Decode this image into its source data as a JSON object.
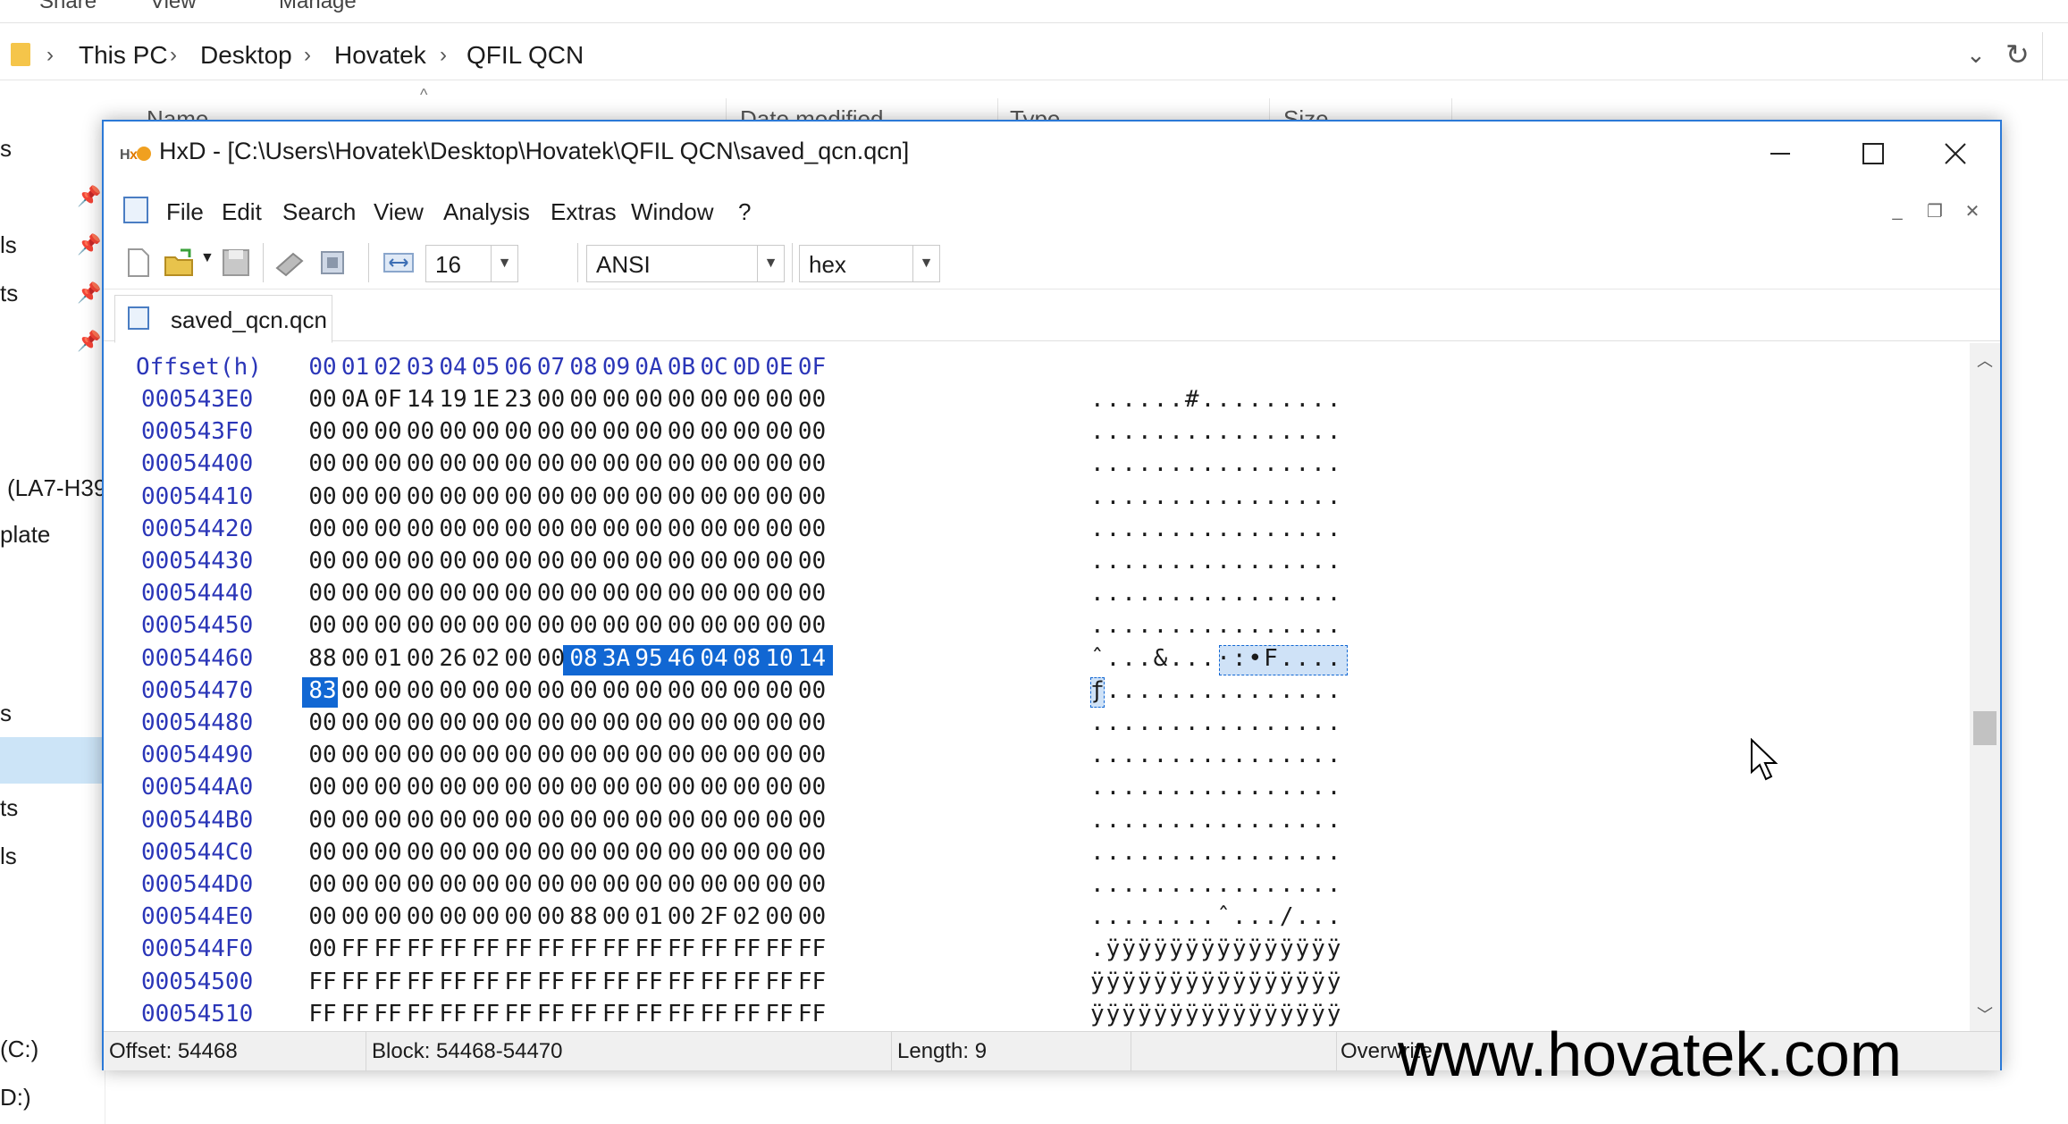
{
  "explorer": {
    "ribbon_tabs": [
      "Share",
      "View",
      "Manage"
    ],
    "breadcrumb": [
      "This PC",
      "Desktop",
      "Hovatek",
      "QFIL QCN"
    ],
    "columns": [
      "Name",
      "Date modified",
      "Type",
      "Size"
    ],
    "nav_items": [
      "s",
      "ls",
      "ts",
      "(LA7-H39",
      "plate",
      "s",
      "ts",
      "ls",
      "(C:)",
      "D:)"
    ]
  },
  "hxd": {
    "title": "HxD - [C:\\Users\\Hovatek\\Desktop\\Hovatek\\QFIL QCN\\saved_qcn.qcn]",
    "menu": [
      "File",
      "Edit",
      "Search",
      "View",
      "Analysis",
      "Extras",
      "Window",
      "?"
    ],
    "toolbar": {
      "bytes_per_row": "16",
      "charset": "ANSI",
      "offset_base": "hex"
    },
    "tab_label": "saved_qcn.qcn",
    "header": {
      "offset_label": "Offset(h)",
      "columns": [
        "00",
        "01",
        "02",
        "03",
        "04",
        "05",
        "06",
        "07",
        "08",
        "09",
        "0A",
        "0B",
        "0C",
        "0D",
        "0E",
        "0F"
      ]
    },
    "rows": [
      {
        "offset": "000543E0",
        "bytes": [
          "00",
          "0A",
          "0F",
          "14",
          "19",
          "1E",
          "23",
          "00",
          "00",
          "00",
          "00",
          "00",
          "00",
          "00",
          "00",
          "00"
        ],
        "ascii": "......#........."
      },
      {
        "offset": "000543F0",
        "bytes": [
          "00",
          "00",
          "00",
          "00",
          "00",
          "00",
          "00",
          "00",
          "00",
          "00",
          "00",
          "00",
          "00",
          "00",
          "00",
          "00"
        ],
        "ascii": "................"
      },
      {
        "offset": "00054400",
        "bytes": [
          "00",
          "00",
          "00",
          "00",
          "00",
          "00",
          "00",
          "00",
          "00",
          "00",
          "00",
          "00",
          "00",
          "00",
          "00",
          "00"
        ],
        "ascii": "................"
      },
      {
        "offset": "00054410",
        "bytes": [
          "00",
          "00",
          "00",
          "00",
          "00",
          "00",
          "00",
          "00",
          "00",
          "00",
          "00",
          "00",
          "00",
          "00",
          "00",
          "00"
        ],
        "ascii": "................"
      },
      {
        "offset": "00054420",
        "bytes": [
          "00",
          "00",
          "00",
          "00",
          "00",
          "00",
          "00",
          "00",
          "00",
          "00",
          "00",
          "00",
          "00",
          "00",
          "00",
          "00"
        ],
        "ascii": "................"
      },
      {
        "offset": "00054430",
        "bytes": [
          "00",
          "00",
          "00",
          "00",
          "00",
          "00",
          "00",
          "00",
          "00",
          "00",
          "00",
          "00",
          "00",
          "00",
          "00",
          "00"
        ],
        "ascii": "................"
      },
      {
        "offset": "00054440",
        "bytes": [
          "00",
          "00",
          "00",
          "00",
          "00",
          "00",
          "00",
          "00",
          "00",
          "00",
          "00",
          "00",
          "00",
          "00",
          "00",
          "00"
        ],
        "ascii": "................"
      },
      {
        "offset": "00054450",
        "bytes": [
          "00",
          "00",
          "00",
          "00",
          "00",
          "00",
          "00",
          "00",
          "00",
          "00",
          "00",
          "00",
          "00",
          "00",
          "00",
          "00"
        ],
        "ascii": "................"
      },
      {
        "offset": "00054460",
        "bytes": [
          "88",
          "00",
          "01",
          "00",
          "26",
          "02",
          "00",
          "00",
          "08",
          "3A",
          "95",
          "46",
          "04",
          "08",
          "10",
          "14"
        ],
        "ascii": "ˆ...&...·:•F...."
      },
      {
        "offset": "00054470",
        "bytes": [
          "83",
          "00",
          "00",
          "00",
          "00",
          "00",
          "00",
          "00",
          "00",
          "00",
          "00",
          "00",
          "00",
          "00",
          "00",
          "00"
        ],
        "ascii": "ƒ..............."
      },
      {
        "offset": "00054480",
        "bytes": [
          "00",
          "00",
          "00",
          "00",
          "00",
          "00",
          "00",
          "00",
          "00",
          "00",
          "00",
          "00",
          "00",
          "00",
          "00",
          "00"
        ],
        "ascii": "................"
      },
      {
        "offset": "00054490",
        "bytes": [
          "00",
          "00",
          "00",
          "00",
          "00",
          "00",
          "00",
          "00",
          "00",
          "00",
          "00",
          "00",
          "00",
          "00",
          "00",
          "00"
        ],
        "ascii": "................"
      },
      {
        "offset": "000544A0",
        "bytes": [
          "00",
          "00",
          "00",
          "00",
          "00",
          "00",
          "00",
          "00",
          "00",
          "00",
          "00",
          "00",
          "00",
          "00",
          "00",
          "00"
        ],
        "ascii": "................"
      },
      {
        "offset": "000544B0",
        "bytes": [
          "00",
          "00",
          "00",
          "00",
          "00",
          "00",
          "00",
          "00",
          "00",
          "00",
          "00",
          "00",
          "00",
          "00",
          "00",
          "00"
        ],
        "ascii": "................"
      },
      {
        "offset": "000544C0",
        "bytes": [
          "00",
          "00",
          "00",
          "00",
          "00",
          "00",
          "00",
          "00",
          "00",
          "00",
          "00",
          "00",
          "00",
          "00",
          "00",
          "00"
        ],
        "ascii": "................"
      },
      {
        "offset": "000544D0",
        "bytes": [
          "00",
          "00",
          "00",
          "00",
          "00",
          "00",
          "00",
          "00",
          "00",
          "00",
          "00",
          "00",
          "00",
          "00",
          "00",
          "00"
        ],
        "ascii": "................"
      },
      {
        "offset": "000544E0",
        "bytes": [
          "00",
          "00",
          "00",
          "00",
          "00",
          "00",
          "00",
          "00",
          "88",
          "00",
          "01",
          "00",
          "2F",
          "02",
          "00",
          "00"
        ],
        "ascii": "........ˆ.../..."
      },
      {
        "offset": "000544F0",
        "bytes": [
          "00",
          "FF",
          "FF",
          "FF",
          "FF",
          "FF",
          "FF",
          "FF",
          "FF",
          "FF",
          "FF",
          "FF",
          "FF",
          "FF",
          "FF",
          "FF"
        ],
        "ascii": ".ÿÿÿÿÿÿÿÿÿÿÿÿÿÿÿ"
      },
      {
        "offset": "00054500",
        "bytes": [
          "FF",
          "FF",
          "FF",
          "FF",
          "FF",
          "FF",
          "FF",
          "FF",
          "FF",
          "FF",
          "FF",
          "FF",
          "FF",
          "FF",
          "FF",
          "FF"
        ],
        "ascii": "ÿÿÿÿÿÿÿÿÿÿÿÿÿÿÿÿ"
      },
      {
        "offset": "00054510",
        "bytes": [
          "FF",
          "FF",
          "FF",
          "FF",
          "FF",
          "FF",
          "FF",
          "FF",
          "FF",
          "FF",
          "FF",
          "FF",
          "FF",
          "FF",
          "FF",
          "FF"
        ],
        "ascii": "ÿÿÿÿÿÿÿÿÿÿÿÿÿÿÿÿ"
      }
    ],
    "selection": {
      "start_offset": "00054468",
      "length": 9
    },
    "status": {
      "offset": "Offset: 54468",
      "block": "Block: 54468-54470",
      "length": "Length: 9",
      "mode": "Overwrite"
    }
  },
  "watermark": "www.hovatek.com",
  "colors": {
    "selection": "#1167d3",
    "offset_text": "#2b36b8",
    "window_border": "#2b79d7"
  }
}
